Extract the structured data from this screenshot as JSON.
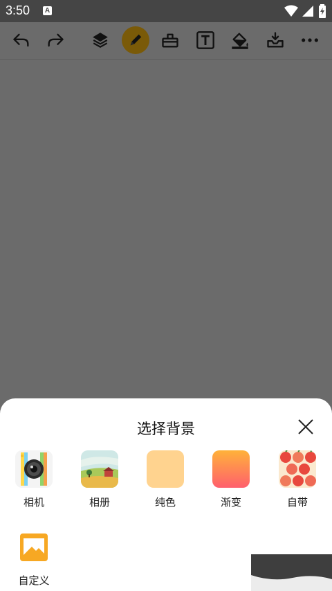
{
  "status_bar": {
    "time": "3:50",
    "badge": "A"
  },
  "toolbar": {
    "icons": [
      "undo-icon",
      "redo-icon",
      "layers-icon",
      "pen-icon",
      "eraser-icon",
      "text-icon",
      "fill-bucket-icon",
      "save-icon",
      "more-icon"
    ],
    "active": "pen-icon",
    "active_color": "#7a5a08"
  },
  "sheet": {
    "title": "选择背景",
    "options": [
      {
        "label": "相机",
        "icon": "camera-icon"
      },
      {
        "label": "相册",
        "icon": "album-landscape-icon"
      },
      {
        "label": "纯色",
        "icon": "solid-color-icon",
        "color": "#ffd38f"
      },
      {
        "label": "渐变",
        "icon": "gradient-icon",
        "colors": [
          "#ffb23a",
          "#ff5f6d"
        ]
      },
      {
        "label": "自带",
        "icon": "builtin-pattern-icon"
      },
      {
        "label": "自定义",
        "icon": "custom-image-icon",
        "color": "#f7a823"
      }
    ]
  }
}
